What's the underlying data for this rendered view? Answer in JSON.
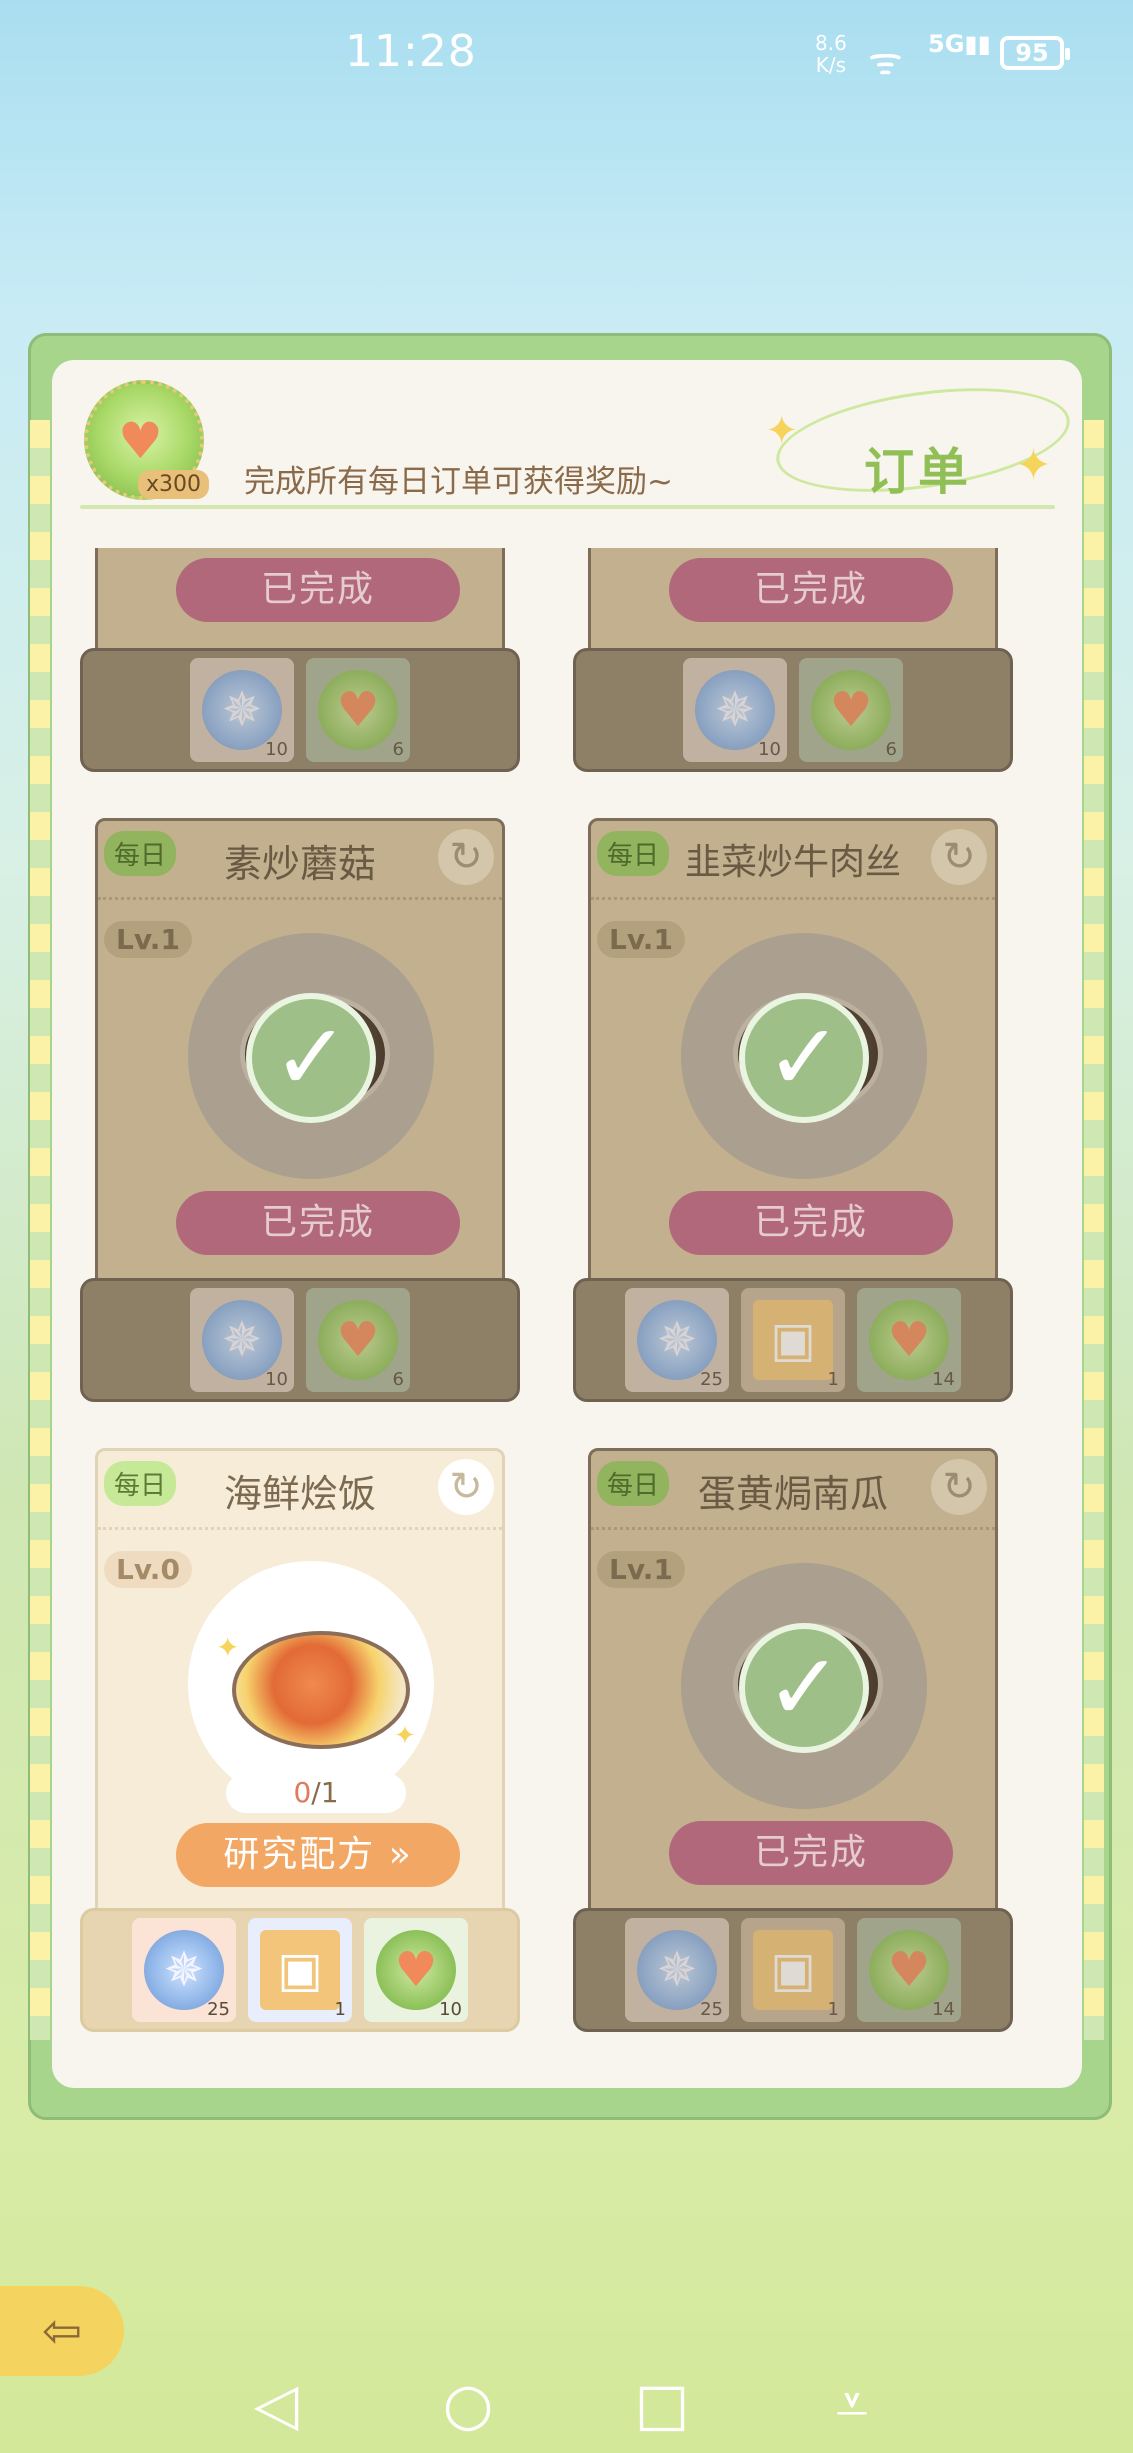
{
  "status_bar": {
    "time": "11:28",
    "net_speed": "8.6",
    "net_unit": "K/s",
    "network": "5G",
    "battery": "95"
  },
  "header": {
    "reward_count": "x300",
    "description": "完成所有每日订单可获得奖励~",
    "title": "订单"
  },
  "labels": {
    "completed": "已完成",
    "research": "研究配方 »",
    "daily_tag": "每日"
  },
  "cards": [
    {
      "rewards": [
        {
          "icon": "compass-icon",
          "count": "10"
        },
        {
          "icon": "heart-fruit-icon",
          "count": "6"
        }
      ]
    },
    {
      "rewards": [
        {
          "icon": "compass-icon",
          "count": "10"
        },
        {
          "icon": "heart-fruit-icon",
          "count": "6"
        }
      ]
    },
    {
      "tag": "每日",
      "dish": "素炒蘑菇",
      "level": "Lv.1",
      "status": "已完成",
      "rewards": [
        {
          "icon": "compass-icon",
          "count": "10"
        },
        {
          "icon": "heart-fruit-icon",
          "count": "6"
        }
      ]
    },
    {
      "tag": "每日",
      "dish": "韭菜炒牛肉丝",
      "level": "Lv.1",
      "status": "已完成",
      "rewards": [
        {
          "icon": "compass-icon",
          "count": "25"
        },
        {
          "icon": "gift-box-icon",
          "count": "1"
        },
        {
          "icon": "heart-fruit-icon",
          "count": "14"
        }
      ]
    },
    {
      "tag": "每日",
      "dish": "海鲜烩饭",
      "level": "Lv.0",
      "progress_current": "0",
      "progress_total": "/1",
      "action": "研究配方 »",
      "rewards": [
        {
          "icon": "compass-icon",
          "count": "25"
        },
        {
          "icon": "gift-box-icon",
          "count": "1"
        },
        {
          "icon": "heart-fruit-icon",
          "count": "10"
        }
      ]
    },
    {
      "tag": "每日",
      "dish": "蛋黄焗南瓜",
      "level": "Lv.1",
      "status": "已完成",
      "rewards": [
        {
          "icon": "compass-icon",
          "count": "25"
        },
        {
          "icon": "gift-box-icon",
          "count": "1"
        },
        {
          "icon": "heart-fruit-icon",
          "count": "14"
        }
      ]
    }
  ],
  "nav_bar": {
    "back": "◁",
    "home": "○",
    "recents": "□",
    "menu": "⩡"
  },
  "back_button_icon": "exit-arrow-icon"
}
